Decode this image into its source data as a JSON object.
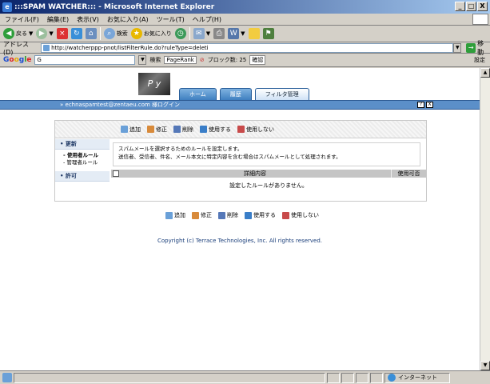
{
  "window": {
    "title": ":::SPAM WATCHER::: - Microsoft Internet Explorer",
    "minimize": "_",
    "maximize": "□",
    "close": "X"
  },
  "menu": [
    "ファイル(F)",
    "編集(E)",
    "表示(V)",
    "お気に入り(A)",
    "ツール(T)",
    "ヘルプ(H)"
  ],
  "toolbar": {
    "back": "戻る",
    "search": "検索",
    "favorites": "お気に入り"
  },
  "address": {
    "label": "アドレス(D)",
    "url": "http://watcherppp-pnot/listFilterRule.do?ruleType=deleti",
    "go": "移動"
  },
  "googlebar": {
    "query": "G",
    "search_label": "検索",
    "pagerank": "PageRank",
    "popup_blocked": "ブロック数: 25",
    "check": "確認",
    "settings": "設定"
  },
  "page": {
    "logo_text": "P y",
    "tabs": [
      {
        "label": "ホーム",
        "active": false
      },
      {
        "label": "履歴",
        "active": false
      },
      {
        "label": "フィルタ管理",
        "active": true
      }
    ],
    "user_line": "» echnaspamtest@zentaeu.com 様ログイン",
    "help_icon": "?",
    "close_icon": "X",
    "actions": [
      "追加",
      "修正",
      "削除",
      "使用する",
      "使用しない"
    ],
    "side": {
      "section_delete": "• 更新",
      "items_delete": [
        "- 使用者ルール",
        "- 管理者ルール"
      ],
      "section_allow": "• 許可"
    },
    "description_line1": "スパムメールを選択するためのルールを設定します。",
    "description_line2": "送信者、受信者、件名、メール本文に特定内容を含む場合はスパムメールとして処理されます。",
    "table_headers": {
      "detail": "詳細内容",
      "use": "使用可否"
    },
    "empty_message": "設定したルールがありません。",
    "copyright": "Copyright (c) Terrace Technologies, Inc. All rights reserved."
  },
  "status": {
    "zone": "インターネット"
  },
  "colors": {
    "titlebar_start": "#0a246a",
    "userbar": "#5b8fc9",
    "tab": "#3f7fc0"
  }
}
